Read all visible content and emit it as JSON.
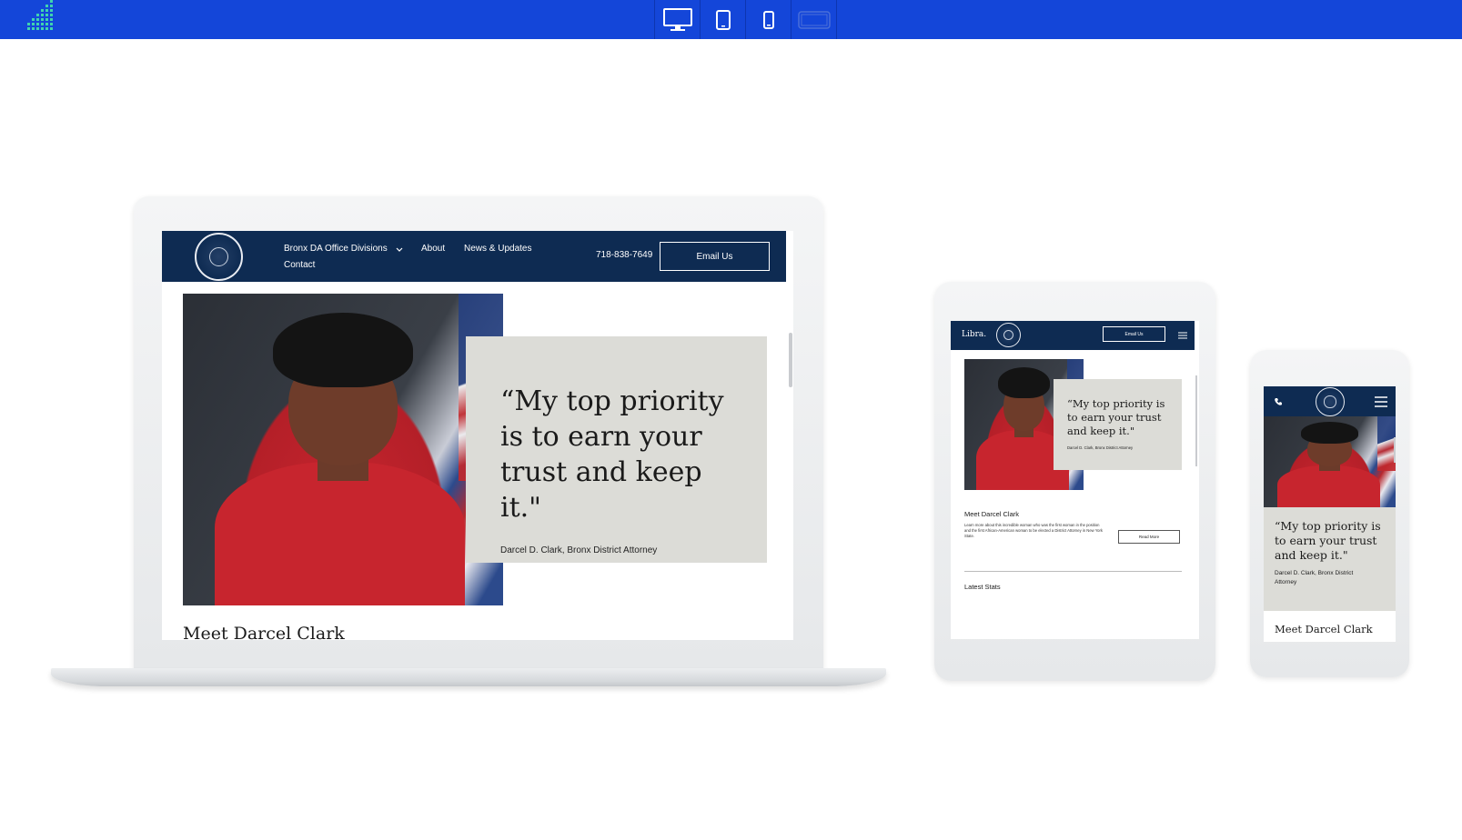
{
  "toolbar": {
    "devices": [
      {
        "icon": "desktop-icon"
      },
      {
        "icon": "tablet-icon"
      },
      {
        "icon": "mobile-icon"
      },
      {
        "icon": "landscape-icon"
      }
    ],
    "colors": {
      "bar": "#1446d9",
      "active": "#ffffff"
    }
  },
  "laptop": {
    "nav": {
      "divisions": "Bronx DA Office Divisions",
      "about": "About",
      "news": "News & Updates",
      "contact": "Contact",
      "phone": "718-838-7649",
      "email_button": "Email Us"
    },
    "hero": {
      "quote": "“My top priority is to earn your trust and keep it.\"",
      "attribution": "Darcel D. Clark, Bronx District Attorney"
    },
    "section_title": "Meet Darcel Clark"
  },
  "tablet": {
    "nav": {
      "brand": "Libra.",
      "email_button": "Email Us"
    },
    "hero": {
      "quote": "“My top priority is to earn your trust and keep it.\"",
      "attribution": "Darcel D. Clark, Bronx District Attorney"
    },
    "meet": {
      "title": "Meet Darcel Clark",
      "text": "Learn more about this incredible woman who was the first woman in the position and the first African-American woman to be elected a District Attorney in New York State.",
      "button": "Read More"
    },
    "stats_title": "Latest Stats"
  },
  "phone": {
    "hero": {
      "quote": "“My top priority is to earn your trust and keep it.\"",
      "attribution": "Darcel D. Clark, Bronx District Attorney"
    },
    "section_title": "Meet Darcel Clark"
  },
  "colors": {
    "navy": "#0e2b52",
    "quote_bg": "#dcdcd7"
  }
}
